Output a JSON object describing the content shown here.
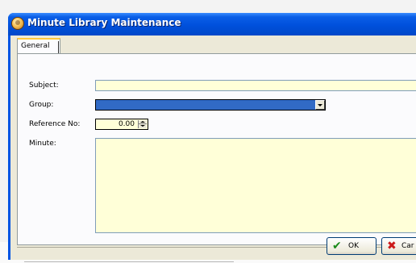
{
  "window": {
    "title": "Minute Library Maintenance"
  },
  "tabs": [
    {
      "label": "General"
    }
  ],
  "form": {
    "subject": {
      "label": "Subject:",
      "value": ""
    },
    "group": {
      "label": "Group:",
      "value": ""
    },
    "reference": {
      "label": "Reference No:",
      "value": "0.00"
    },
    "minute": {
      "label": "Minute:",
      "value": ""
    }
  },
  "buttons": {
    "ok": "OK",
    "cancel": "Car"
  },
  "icons": {
    "app": "app-icon",
    "ok": "check-icon",
    "cancel": "x-icon",
    "dropdown": "chevron-down-icon"
  },
  "colors": {
    "title_bar": "#0054e3",
    "field_bg": "#ffffd8",
    "selection": "#316ac5",
    "check": "#1a8a1a",
    "cross": "#cc1a1a"
  }
}
